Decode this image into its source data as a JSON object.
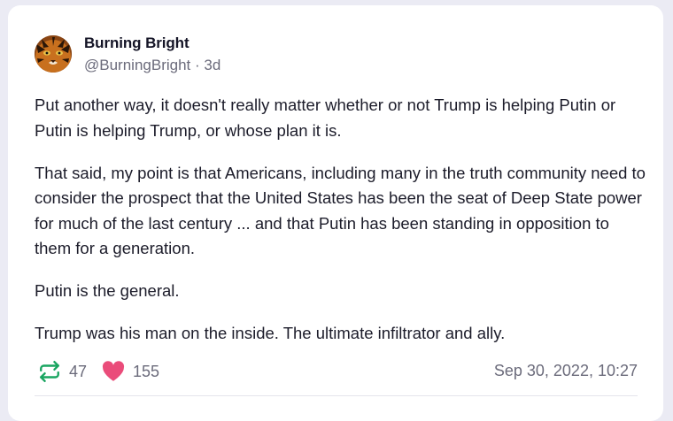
{
  "post": {
    "author": {
      "display_name": "Burning Bright",
      "handle": "@BurningBright",
      "separator": "·",
      "age": "3d",
      "avatar_icon": "tiger-face-avatar"
    },
    "paragraphs": [
      "Put another way, it doesn't really matter whether or not Trump is helping Putin or Putin is helping Trump, or whose plan it is.",
      "That said, my point is that Americans, including many in the truth community need to consider the prospect that the United States has been the seat of Deep State power for much of the last century ... and that Putin has been standing in opposition to them for a generation.",
      "Putin is the general.",
      "Trump was his man on the inside. The ultimate infiltrator and ally."
    ],
    "stats": {
      "reposts": "47",
      "likes": "155",
      "repost_icon": "repost-icon",
      "like_icon": "heart-icon"
    },
    "timestamp": "Sep 30, 2022, 10:27"
  },
  "colors": {
    "background": "#ebebf4",
    "card": "#ffffff",
    "repost_green": "#1aa561",
    "like_pink": "#ea4c7a",
    "muted_text": "#6b6b7b"
  }
}
